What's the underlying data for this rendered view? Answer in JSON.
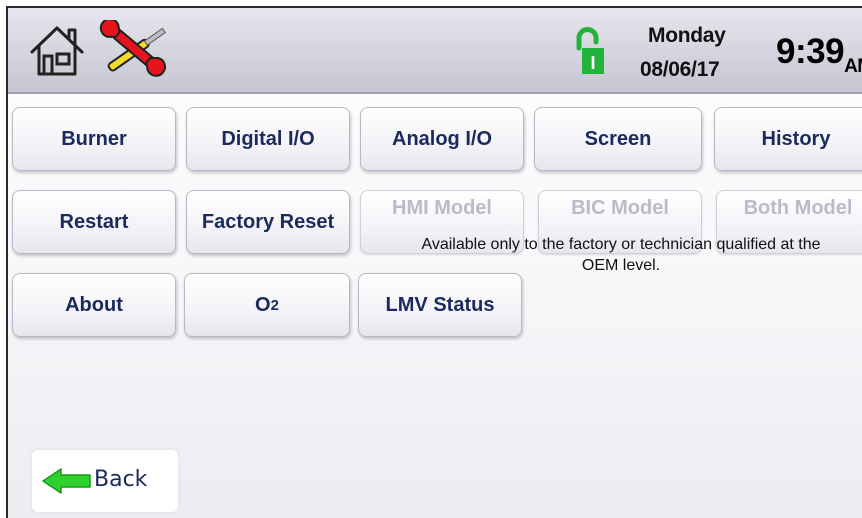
{
  "status": {
    "day": "Monday",
    "date": "08/06/17",
    "time": "9:39",
    "ampm": "AM",
    "lock_letter": "I"
  },
  "icons": {
    "home": "home-icon",
    "tools": "tools-icon",
    "lock": "unlocked-padlock-icon",
    "back": "left-arrow-icon"
  },
  "menu": {
    "burner": "Burner",
    "digital_io": "Digital I/O",
    "analog_io": "Analog I/O",
    "screen": "Screen",
    "history": "History",
    "restart": "Restart",
    "factory_reset": "Factory Reset",
    "hmi_model": "HMI Model",
    "bic_model": "BIC Model",
    "both_model": "Both Model",
    "about": "About",
    "o2_main": "O",
    "o2_sub": "2",
    "lmv_status": "LMV Status"
  },
  "notice": "Available only to the factory or technician qualified at the OEM level.",
  "back_label": "Back",
  "colors": {
    "button_text": "#1a2a5c",
    "disabled_text": "#b9bcc8",
    "lock_green": "#22b33b",
    "back_arrow_green": "#2ed12e",
    "tools_red": "#e6141c",
    "tools_yellow": "#f2dc2a"
  }
}
